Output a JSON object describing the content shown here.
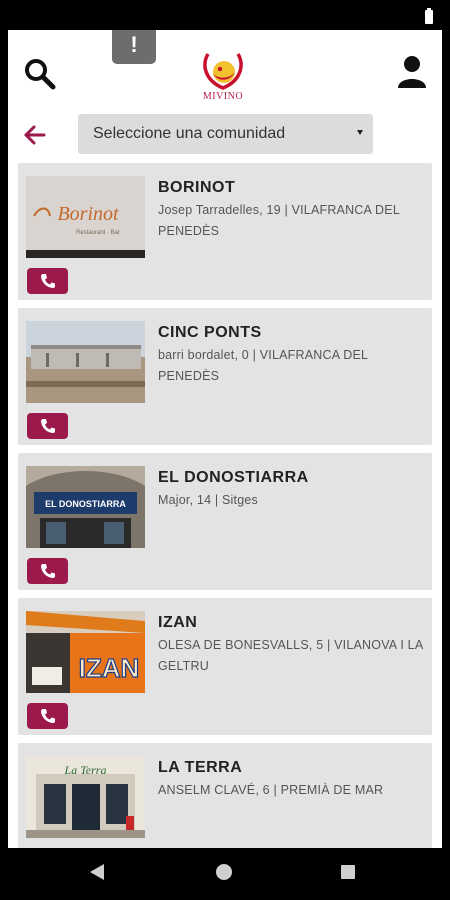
{
  "app": {
    "logo_text": "MIVINO",
    "notice_label": "!",
    "brand_color": "#9b1a4b"
  },
  "filter": {
    "selected": "Seleccione una comunidad"
  },
  "places": [
    {
      "name": "BORINOT",
      "address": "Josep Tarradelles, 19 | VILAFRANCA DEL PENEDÈS",
      "sign_text": "Borinot",
      "sign_sub": "Restaurant · Bar"
    },
    {
      "name": "CINC PONTS",
      "address": "barri bordalet, 0 | VILAFRANCA DEL PENEDÈS"
    },
    {
      "name": "EL DONOSTIARRA",
      "address": "Major, 14 | Sitges",
      "sign_text": "EL DONOSTIARRA"
    },
    {
      "name": "IZAN",
      "address": "OLESA DE BONESVALLS, 5 | VILANOVA I LA GELTRU",
      "sign_text": "IZAN"
    },
    {
      "name": "LA TERRA",
      "address": "ANSELM CLAVÉ, 6 | PREMIÀ DE MAR",
      "sign_text": "La Terra"
    }
  ],
  "icons": {
    "search": "search-icon",
    "user": "user-icon",
    "back": "back-arrow-icon",
    "phone": "phone-icon",
    "dropdown": "caret-down-icon"
  }
}
